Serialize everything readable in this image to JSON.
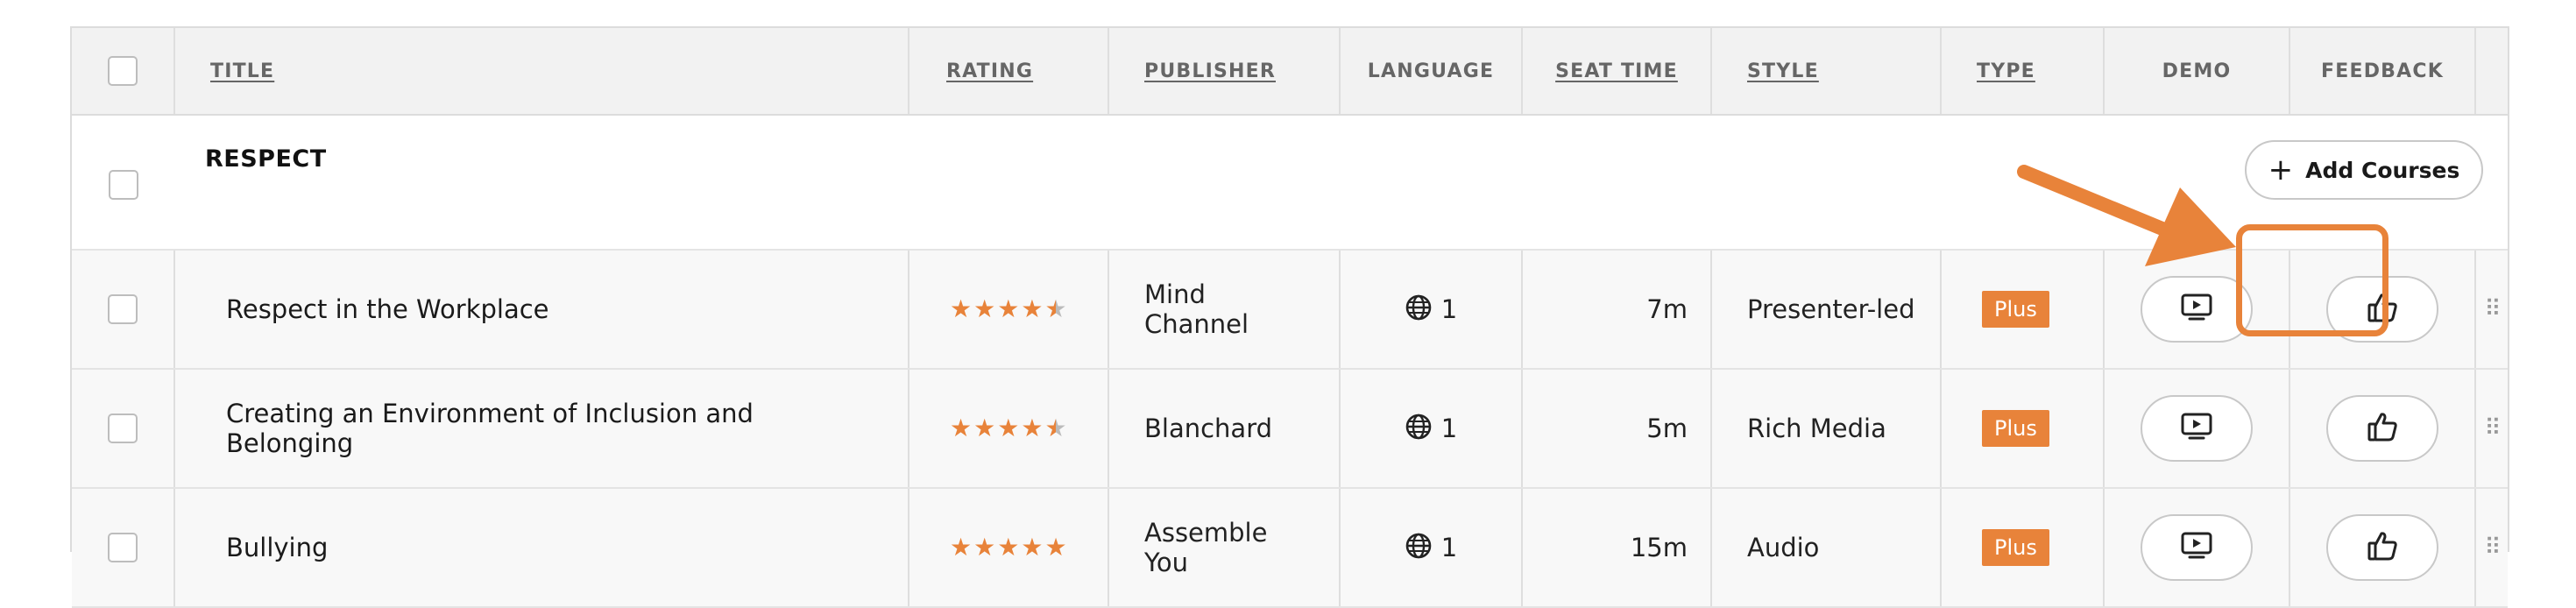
{
  "header": {
    "title": "TITLE",
    "rating": "RATING",
    "publisher": "PUBLISHER",
    "language": "LANGUAGE",
    "seat_time": "SEAT TIME",
    "style": "STYLE",
    "type": "TYPE",
    "demo": "DEMO",
    "feedback": "FEEDBACK"
  },
  "group": {
    "name": "RESPECT",
    "add_button_label": "Add Courses",
    "add_icon": "plus-icon"
  },
  "rows": [
    {
      "title": "Respect in the Workplace",
      "rating": 4.5,
      "publisher": "Mind Channel",
      "language_count": "1",
      "seat_time": "7m",
      "style": "Presenter-led",
      "type": "Plus"
    },
    {
      "title": "Creating an Environment of Inclusion and Belonging",
      "rating": 4.5,
      "publisher": "Blanchard",
      "language_count": "1",
      "seat_time": "5m",
      "style": "Rich Media",
      "type": "Plus"
    },
    {
      "title": "Bullying",
      "rating": 5,
      "publisher": "Assemble You",
      "language_count": "1",
      "seat_time": "15m",
      "style": "Audio",
      "type": "Plus"
    }
  ],
  "icons": {
    "language": "globe-icon",
    "demo": "play-screen-icon",
    "feedback": "thumbs-up-icon",
    "drag": "drag-handle-icon"
  },
  "colors": {
    "accent": "#e8833a",
    "header_bg": "#f2f2f2",
    "row_bg": "#f8f8f8",
    "border": "#dcdcdc"
  }
}
